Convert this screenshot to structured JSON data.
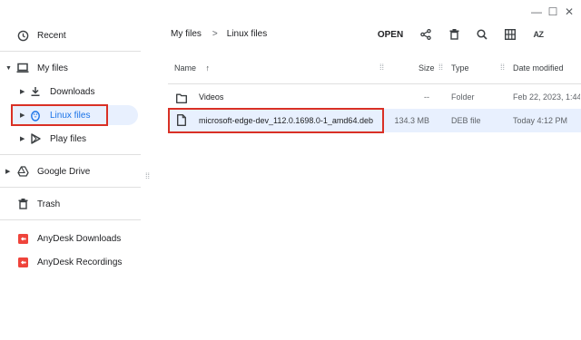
{
  "window": {
    "minimize": "—",
    "maximize": "☐",
    "close": "✕"
  },
  "sidebar": {
    "recent": "Recent",
    "my_files": "My files",
    "downloads": "Downloads",
    "linux_files": "Linux files",
    "play_files": "Play files",
    "google_drive": "Google Drive",
    "trash": "Trash",
    "anydesk_downloads": "AnyDesk Downloads",
    "anydesk_recordings": "AnyDesk Recordings"
  },
  "breadcrumb": {
    "root": "My files",
    "separator": ">",
    "current": "Linux files"
  },
  "toolbar": {
    "open": "OPEN",
    "sort_glyph": "AZ"
  },
  "columns": {
    "name": "Name",
    "size": "Size",
    "type": "Type",
    "date": "Date modified",
    "sort_arrow": "↑"
  },
  "files": [
    {
      "name": "Videos",
      "size": "--",
      "type": "Folder",
      "date": "Feb 22, 2023, 1:44 ...",
      "icon": "folder-icon"
    },
    {
      "name": "microsoft-edge-dev_112.0.1698.0-1_amd64.deb",
      "size": "134.3 MB",
      "type": "DEB file",
      "date": "Today 4:12 PM",
      "icon": "file-icon"
    }
  ],
  "colors": {
    "accent": "#1a73e8",
    "selected": "#e8f0fe",
    "highlight": "#d93025",
    "anydesk": "#ef443b"
  }
}
